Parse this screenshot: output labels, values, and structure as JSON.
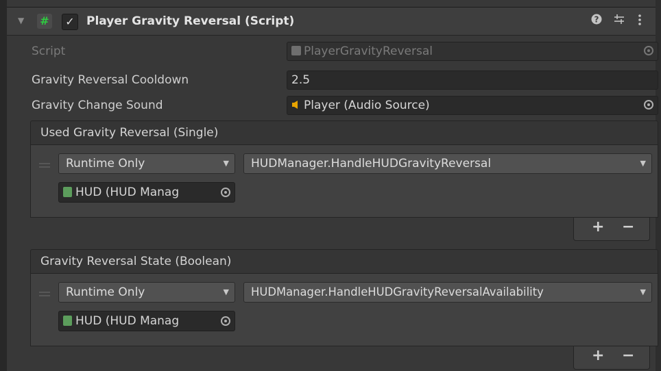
{
  "component": {
    "title": "Player Gravity Reversal (Script)",
    "enabled_glyph": "✓",
    "script_badge_glyph": "#",
    "icons": [
      "foldout-arrow-icon",
      "script-icon",
      "help-icon",
      "preset-icon",
      "kebab-menu-icon"
    ]
  },
  "fields": {
    "script": {
      "label": "Script",
      "value": "PlayerGravityReversal"
    },
    "cooldown": {
      "label": "Gravity Reversal Cooldown",
      "value": "2.5"
    },
    "sound": {
      "label": "Gravity Change Sound",
      "value": "Player (Audio Source)"
    }
  },
  "events": [
    {
      "header": "Used Gravity Reversal (Single)",
      "runtime": "Runtime Only",
      "function": "HUDManager.HandleHUDGravityReversal",
      "target": "HUD (HUD Manag"
    },
    {
      "header": "Gravity Reversal State (Boolean)",
      "runtime": "Runtime Only",
      "function": "HUDManager.HandleHUDGravityReversalAvailability",
      "target": "HUD (HUD Manag"
    }
  ],
  "buttons": {
    "plus": "+",
    "minus": "−"
  },
  "colors": {
    "script_badge": "#2ecc40",
    "audio_icon": "#e8a400",
    "panel_bg": "#383838"
  }
}
